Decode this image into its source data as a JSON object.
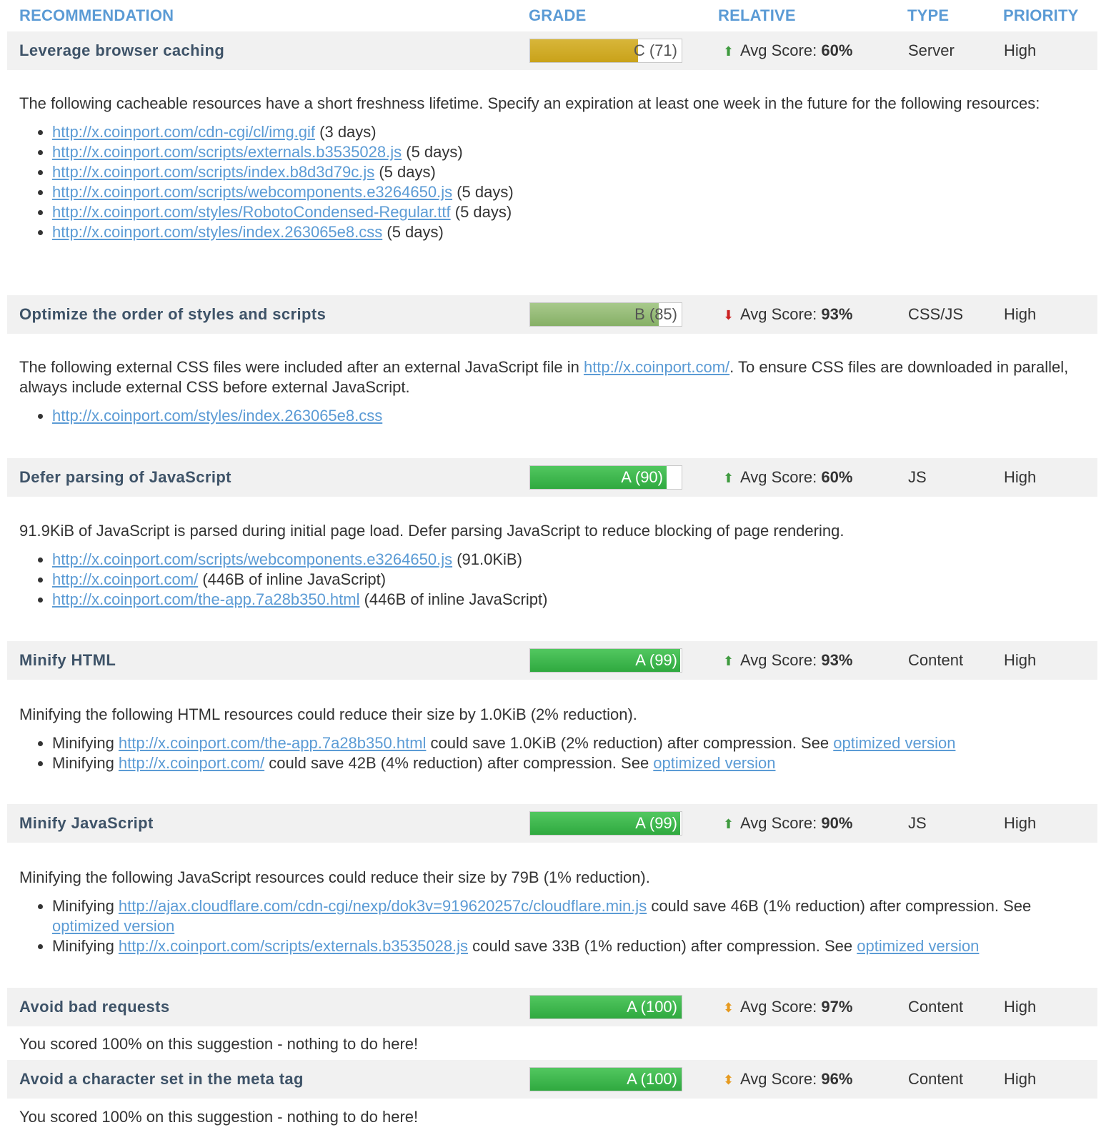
{
  "header": {
    "recommendation": "RECOMMENDATION",
    "grade": "GRADE",
    "relative": "RELATIVE",
    "type": "TYPE",
    "priority": "PRIORITY"
  },
  "avg_label": "Avg Score:",
  "colors": {
    "header_text": "#5b9bd5",
    "row_bg": "#f1f1f1",
    "title_text": "#3e5368",
    "grade_c": "#c9a21a",
    "grade_b": "#86b066",
    "grade_a": "#2fa93f",
    "arrow_up": "#3f9a3f",
    "arrow_down": "#cc2222",
    "arrow_equal": "#e69a1f",
    "link": "#5b9bd5"
  },
  "rows": [
    {
      "title": "Leverage browser caching",
      "grade_text": "C (71)",
      "grade_percent": 71,
      "relative_icon": "arrow-up-icon",
      "avg_value": "60%",
      "type": "Server",
      "priority": "High",
      "description": "The following cacheable resources have a short freshness lifetime. Specify an expiration at least one week in the future for the following resources:",
      "items": [
        {
          "link": "http://x.coinport.com/cdn-cgi/cl/img.gif",
          "suffix": " (3 days)"
        },
        {
          "link": "http://x.coinport.com/scripts/externals.b3535028.js",
          "suffix": " (5 days)"
        },
        {
          "link": "http://x.coinport.com/scripts/index.b8d3d79c.js",
          "suffix": " (5 days)"
        },
        {
          "link": "http://x.coinport.com/scripts/webcomponents.e3264650.js",
          "suffix": " (5 days)"
        },
        {
          "link": "http://x.coinport.com/styles/RobotoCondensed-Regular.ttf",
          "suffix": " (5 days)"
        },
        {
          "link": "http://x.coinport.com/styles/index.263065e8.css",
          "suffix": " (5 days)"
        }
      ]
    },
    {
      "title": "Optimize the order of styles and scripts",
      "grade_text": "B (85)",
      "grade_percent": 85,
      "relative_icon": "arrow-down-icon",
      "avg_value": "93%",
      "type": "CSS/JS",
      "priority": "High",
      "description_pre": "The following external CSS files were included after an external JavaScript file in ",
      "description_link": "http://x.coinport.com/",
      "description_post": ". To ensure CSS files are downloaded in parallel, always include external CSS before external JavaScript.",
      "items": [
        {
          "link": "http://x.coinport.com/styles/index.263065e8.css",
          "suffix": ""
        }
      ]
    },
    {
      "title": "Defer parsing of JavaScript",
      "grade_text": "A (90)",
      "grade_percent": 90,
      "relative_icon": "arrow-up-icon",
      "avg_value": "60%",
      "type": "JS",
      "priority": "High",
      "description": "91.9KiB of JavaScript is parsed during initial page load. Defer parsing JavaScript to reduce blocking of page rendering.",
      "items": [
        {
          "link": "http://x.coinport.com/scripts/webcomponents.e3264650.js",
          "suffix": " (91.0KiB)"
        },
        {
          "link": "http://x.coinport.com/",
          "suffix": " (446B of inline JavaScript)"
        },
        {
          "link": "http://x.coinport.com/the-app.7a28b350.html",
          "suffix": " (446B of inline JavaScript)"
        }
      ]
    },
    {
      "title": "Minify HTML",
      "grade_text": "A (99)",
      "grade_percent": 99,
      "relative_icon": "arrow-up-icon",
      "avg_value": "93%",
      "type": "Content",
      "priority": "High",
      "description": "Minifying the following HTML resources could reduce their size by 1.0KiB (2% reduction).",
      "items": [
        {
          "prefix": "Minifying ",
          "link": "http://x.coinport.com/the-app.7a28b350.html",
          "suffix": " could save 1.0KiB (2% reduction) after compression. See ",
          "link2": "optimized version"
        },
        {
          "prefix": "Minifying ",
          "link": "http://x.coinport.com/",
          "suffix": " could save 42B (4% reduction) after compression. See ",
          "link2": "optimized version"
        }
      ]
    },
    {
      "title": "Minify JavaScript",
      "grade_text": "A (99)",
      "grade_percent": 99,
      "relative_icon": "arrow-up-icon",
      "avg_value": "90%",
      "type": "JS",
      "priority": "High",
      "description": "Minifying the following JavaScript resources could reduce their size by 79B (1% reduction).",
      "items": [
        {
          "prefix": "Minifying ",
          "link": "http://ajax.cloudflare.com/cdn-cgi/nexp/dok3v=919620257c/cloudflare.min.js",
          "suffix": " could save 46B (1% reduction) after compression. See ",
          "link2": "optimized version"
        },
        {
          "prefix": "Minifying ",
          "link": "http://x.coinport.com/scripts/externals.b3535028.js",
          "suffix": " could save 33B (1% reduction) after compression. See ",
          "link2": "optimized version"
        }
      ]
    },
    {
      "title": "Avoid bad requests",
      "grade_text": "A (100)",
      "grade_percent": 100,
      "relative_icon": "arrow-updown-icon",
      "avg_value": "97%",
      "type": "Content",
      "priority": "High",
      "description": "You scored 100% on this suggestion - nothing to do here!"
    },
    {
      "title": "Avoid a character set in the meta tag",
      "grade_text": "A (100)",
      "grade_percent": 100,
      "relative_icon": "arrow-updown-icon",
      "avg_value": "96%",
      "type": "Content",
      "priority": "High",
      "description": "You scored 100% on this suggestion - nothing to do here!"
    }
  ]
}
